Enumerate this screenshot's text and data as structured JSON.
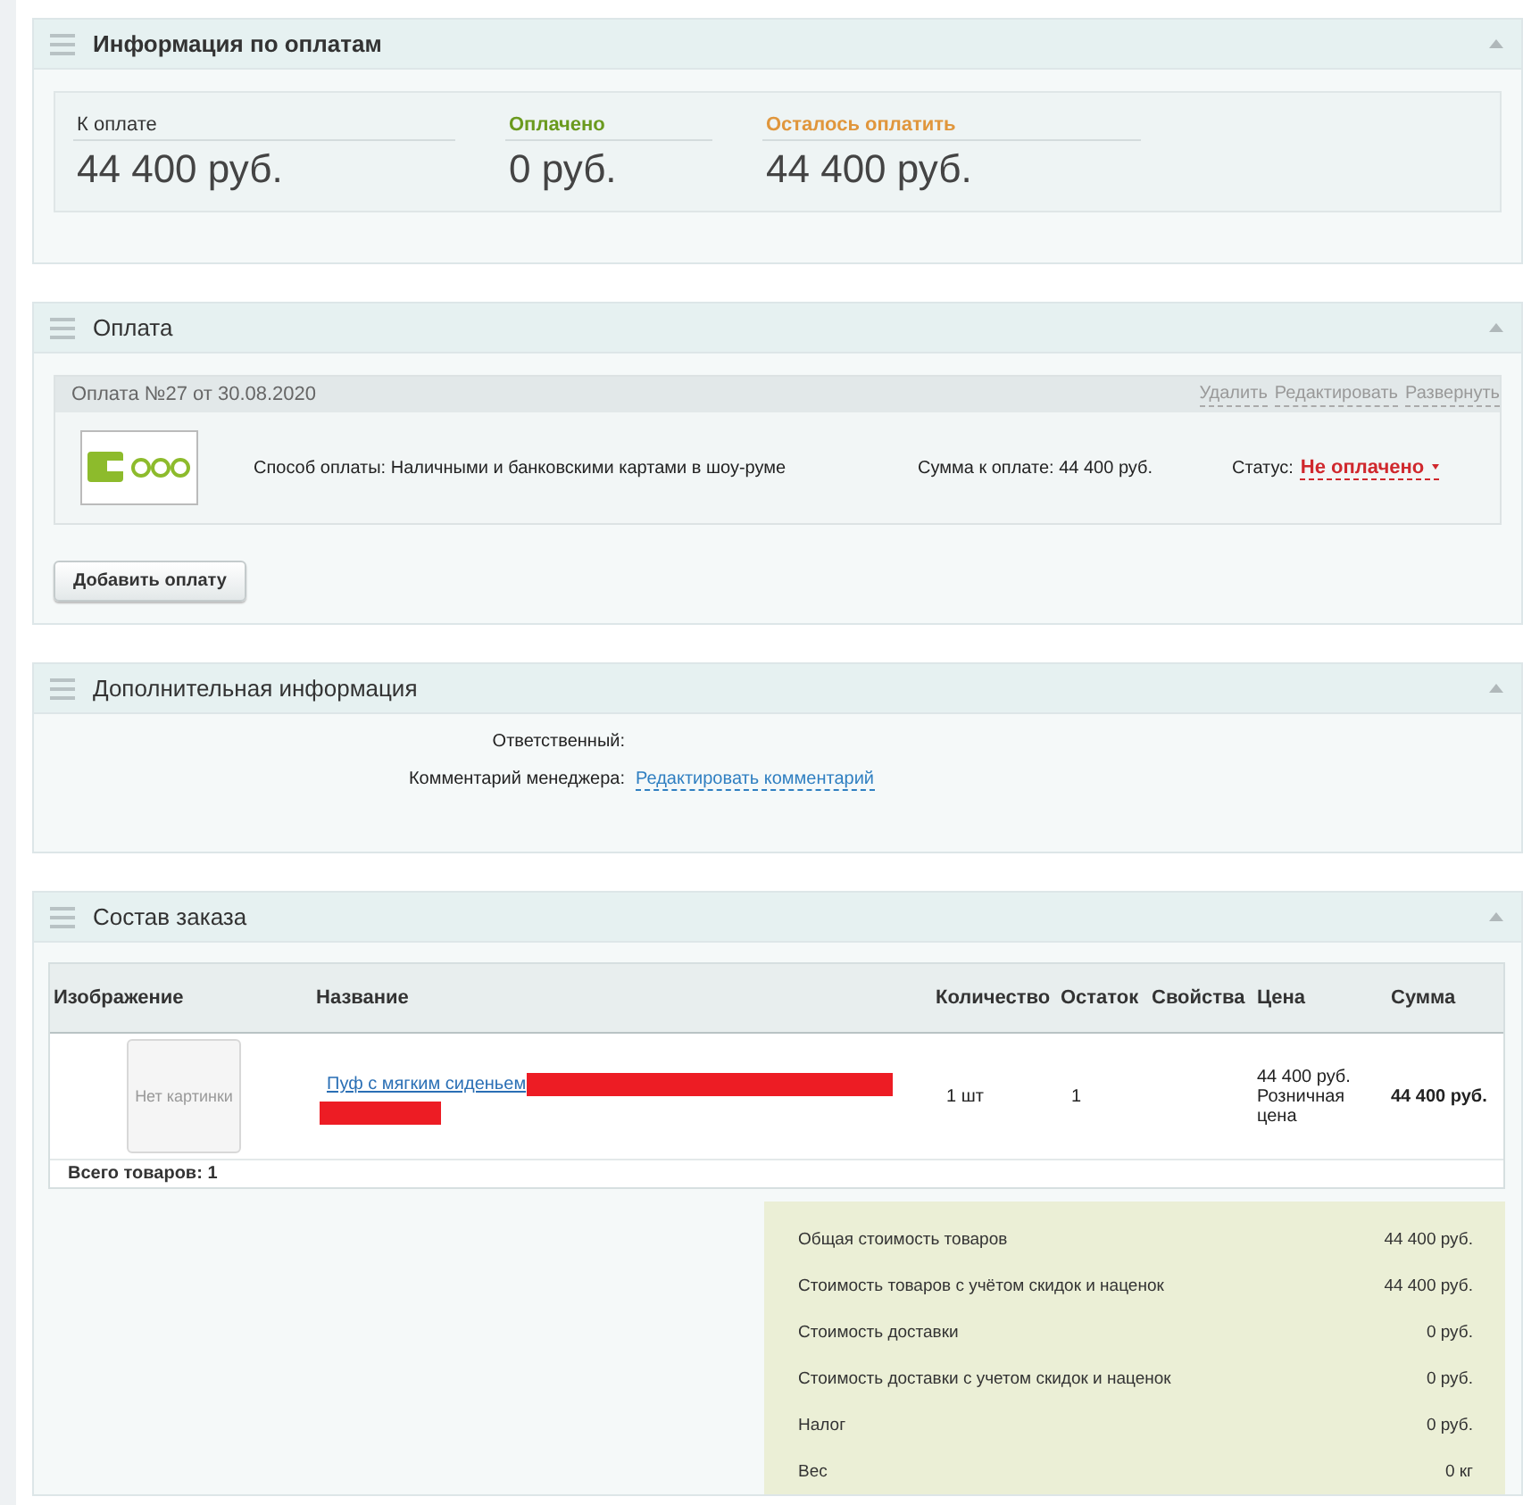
{
  "payment_info": {
    "title": "Информация по оплатам",
    "expanded": true,
    "summary": [
      {
        "kind": "due",
        "label": "К оплате",
        "value": "44 400 руб."
      },
      {
        "kind": "paid",
        "label": "Оплачено",
        "value": "0 руб."
      },
      {
        "kind": "left",
        "label": "Осталось оплатить",
        "value": "44 400 руб."
      }
    ]
  },
  "payment": {
    "title": "Оплата",
    "expanded": true,
    "entry": {
      "title": "Оплата №27 от 30.08.2020",
      "actions": [
        "Удалить",
        "Редактировать",
        "Развернуть"
      ],
      "method": "Способ оплаты: Наличными и банковскими картами в шоу-руме",
      "amount": "Сумма к оплате: 44 400 руб.",
      "status_label": "Статус:",
      "status": "Не оплачено",
      "paid": false
    },
    "add_button": "Добавить оплату"
  },
  "extra": {
    "title": "Дополнительная информация",
    "expanded": true,
    "fields": [
      {
        "label": "Ответственный:"
      },
      {
        "label": "Комментарий менеджера:",
        "link": "Редактировать комментарий"
      }
    ]
  },
  "order": {
    "title": "Состав заказа",
    "expanded": true,
    "columns": [
      "Изображение",
      "Название",
      "Количество",
      "Остаток",
      "Свойства",
      "Цена",
      "Сумма"
    ],
    "rows": [
      {
        "image": "Нет картинки",
        "name": "Пуф с мягким сиденьем",
        "quantity": "1 шт",
        "stock": "1",
        "price": "44 400 руб.",
        "price_type": "Розничная цена",
        "sum": "44 400 руб."
      }
    ],
    "total_items": "Всего товаров: 1",
    "totals": [
      {
        "label": "Общая стоимость товаров",
        "value": "44 400 руб."
      },
      {
        "label": "Стоимость товаров с учётом скидок и наценок",
        "value": "44 400 руб."
      },
      {
        "label": "Стоимость доставки",
        "value": "0 руб."
      },
      {
        "label": "Стоимость доставки с учетом скидок и наценок",
        "value": "0 руб."
      },
      {
        "label": "Налог",
        "value": "0 руб."
      },
      {
        "label": "Вес",
        "value": "0 кг"
      }
    ]
  }
}
